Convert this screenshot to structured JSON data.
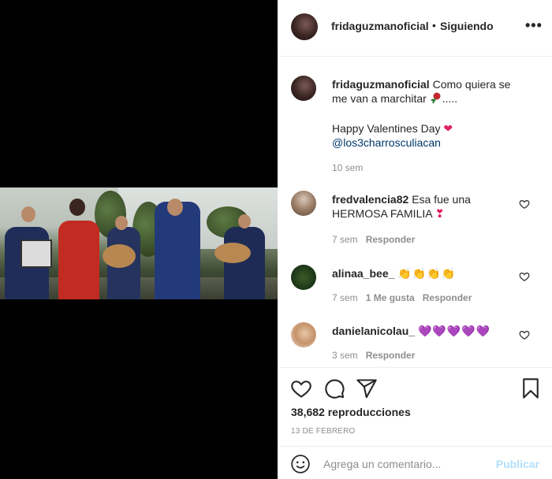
{
  "post": {
    "username": "fridaguzmanoficial",
    "follow_separator": "•",
    "follow_status": "Siguiendo",
    "more_label": "•••"
  },
  "caption": {
    "username": "fridaguzmanoficial",
    "line1": "Como quiera se me van a marchitar",
    "line1_suffix": ".....",
    "line2": "Happy Valentines Day",
    "mention": "@los3charrosculiacan",
    "age": "10 sem"
  },
  "comments": [
    {
      "username": "fredvalencia82",
      "text": "Esa fue una HERMOSA FAMILIA",
      "emoji": "❣",
      "age": "7 sem",
      "likes": "",
      "reply": "Responder"
    },
    {
      "username": "alinaa_bee_",
      "text": "",
      "emoji": "👏👏👏👏",
      "age": "7 sem",
      "likes": "1 Me gusta",
      "reply": "Responder"
    },
    {
      "username": "danielanicolau_",
      "text": "",
      "emoji": "💜💜💜💜💜",
      "age": "3 sem",
      "likes": "",
      "reply": "Responder"
    }
  ],
  "stats": {
    "views": "38,682 reproducciones",
    "date": "13 DE FEBRERO"
  },
  "add_comment": {
    "placeholder": "Agrega un comentario...",
    "post_label": "Publicar"
  },
  "icons": {
    "like": "heart-icon",
    "comment": "comment-icon",
    "share": "share-icon",
    "save": "bookmark-icon",
    "emoji": "smile-icon",
    "more": "more-icon"
  },
  "colors": {
    "accent": "#0095f6",
    "post_disabled": "#b2dffc",
    "link": "#00376b",
    "meta": "#8e8e8e",
    "text": "#262626"
  }
}
